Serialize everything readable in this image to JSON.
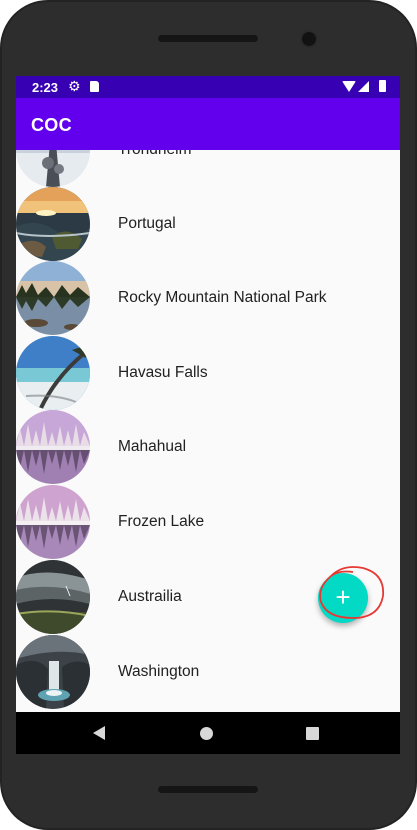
{
  "status_bar": {
    "time": "2:23",
    "icons": [
      "settings-gear-icon",
      "sd-card-icon",
      "wifi-icon",
      "cell-signal-icon",
      "battery-icon"
    ]
  },
  "app_bar": {
    "title": "COC",
    "color": "#6200ee",
    "status_color": "#3700b3"
  },
  "list": {
    "items": [
      {
        "label": "Trondheim",
        "image": "tower-in-snow"
      },
      {
        "label": "Portugal",
        "image": "rocky-shore-sunset"
      },
      {
        "label": "Rocky Mountain National Park",
        "image": "lake-reflection-forest"
      },
      {
        "label": "Havasu Falls",
        "image": "beach-with-leaning-tree"
      },
      {
        "label": "Mahahual",
        "image": "snowy-forest-lake-pink-sky"
      },
      {
        "label": "Frozen Lake",
        "image": "snowy-forest-lake-pink-sky"
      },
      {
        "label": "Austrailia",
        "image": "stormy-sky-landscape"
      },
      {
        "label": "Washington",
        "image": "waterfall-canyon"
      }
    ]
  },
  "fab": {
    "label": "+",
    "color": "#03dac5",
    "icon": "add-icon"
  },
  "nav_bar": {
    "back": "back-icon",
    "home": "home-icon",
    "recents": "recents-icon"
  },
  "annotation": {
    "color": "#e53935"
  }
}
